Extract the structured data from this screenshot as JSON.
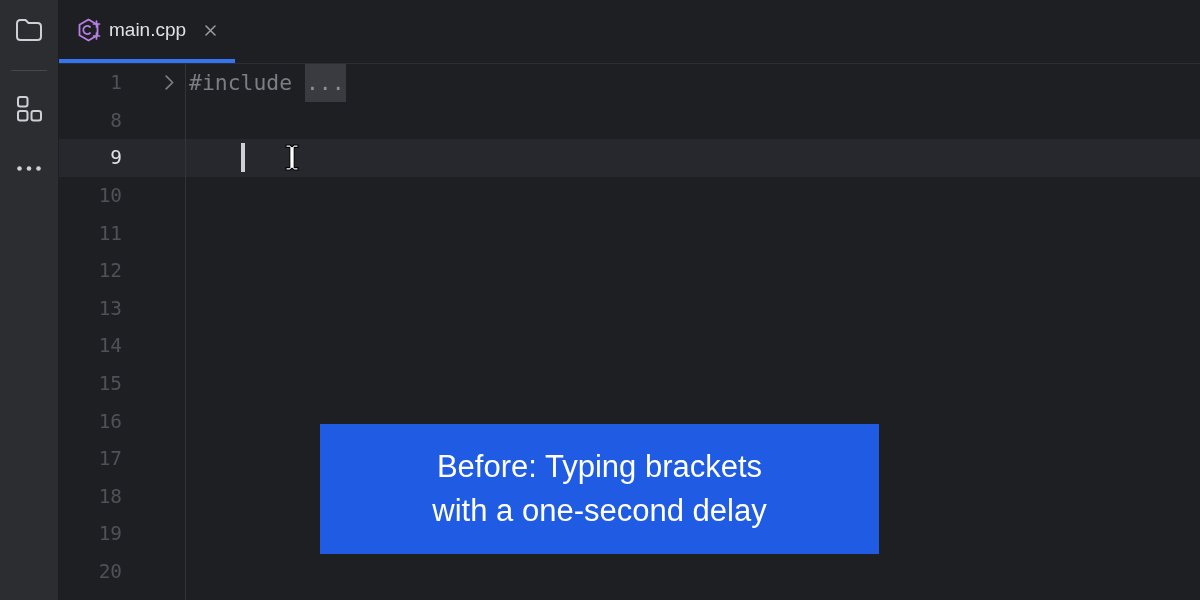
{
  "tabs": [
    {
      "label": "main.cpp",
      "selected": true
    }
  ],
  "editor": {
    "lines": [
      {
        "number": "1",
        "text": "#include",
        "folded": true,
        "fold_placeholder": "...",
        "current": false
      },
      {
        "number": "8",
        "folded": false,
        "current": false
      },
      {
        "number": "9",
        "folded": false,
        "current": true
      },
      {
        "number": "10",
        "folded": false,
        "current": false
      },
      {
        "number": "11",
        "folded": false,
        "current": false
      },
      {
        "number": "12",
        "folded": false,
        "current": false
      },
      {
        "number": "13",
        "folded": false,
        "current": false
      },
      {
        "number": "14",
        "folded": false,
        "current": false
      },
      {
        "number": "15",
        "folded": false,
        "current": false
      },
      {
        "number": "16",
        "folded": false,
        "current": false
      },
      {
        "number": "17",
        "folded": false,
        "current": false
      },
      {
        "number": "18",
        "folded": false,
        "current": false
      },
      {
        "number": "19",
        "folded": false,
        "current": false
      },
      {
        "number": "20",
        "folded": false,
        "current": false
      }
    ]
  },
  "caption": {
    "text": "Before: Typing brackets\nwith a one-second delay"
  }
}
